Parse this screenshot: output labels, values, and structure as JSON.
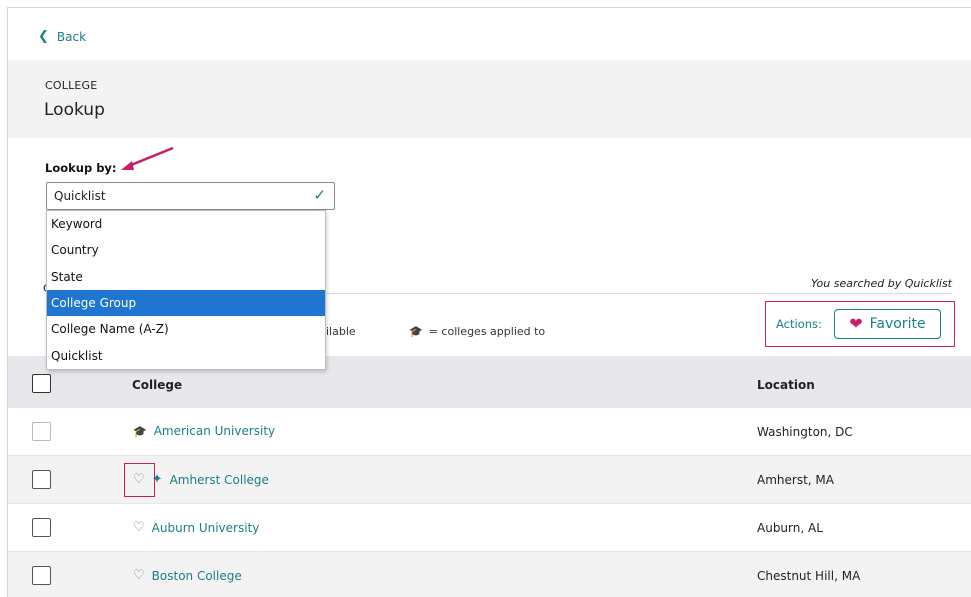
{
  "nav": {
    "back_label": "Back"
  },
  "header": {
    "eyebrow": "COLLEGE",
    "title": "Lookup"
  },
  "lookup": {
    "label": "Lookup by:",
    "selected": "Quicklist",
    "options": [
      "Keyword",
      "Country",
      "State",
      "College Group",
      "College Name (A-Z)",
      "Quicklist"
    ],
    "highlighted_option": "College Group"
  },
  "search_note": "You searched by Quicklist",
  "legend": {
    "partial_text": "ilable",
    "applied_text": "= colleges applied to",
    "faint_letter": "C"
  },
  "actions": {
    "label": "Actions:",
    "favorite_label": "Favorite"
  },
  "table": {
    "columns": {
      "college": "College",
      "location": "Location"
    },
    "rows": [
      {
        "college": "American University",
        "location": "Washington, DC",
        "icon": "graduation-cap-icon"
      },
      {
        "college": "Amherst College",
        "location": "Amherst, MA",
        "icon": "sparkle-icon"
      },
      {
        "college": "Auburn University",
        "location": "Auburn, AL",
        "icon": "heart-outline-icon"
      },
      {
        "college": "Boston College",
        "location": "Chestnut Hill, MA",
        "icon": "heart-outline-icon"
      }
    ]
  },
  "colors": {
    "accent": "#1a7f86",
    "highlight": "#c91c6a",
    "selected_option": "#1f76d1"
  }
}
